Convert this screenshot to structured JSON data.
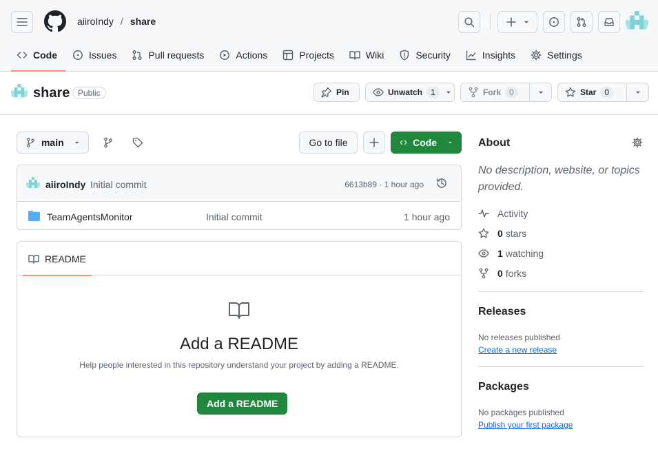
{
  "header": {
    "owner": "aiiroIndy",
    "separator": "/",
    "repo": "share"
  },
  "tabs": [
    {
      "label": "Code",
      "icon": "code-icon",
      "active": true
    },
    {
      "label": "Issues",
      "icon": "issue-icon"
    },
    {
      "label": "Pull requests",
      "icon": "pull-request-icon"
    },
    {
      "label": "Actions",
      "icon": "play-icon"
    },
    {
      "label": "Projects",
      "icon": "table-icon"
    },
    {
      "label": "Wiki",
      "icon": "book-icon"
    },
    {
      "label": "Security",
      "icon": "shield-icon"
    },
    {
      "label": "Insights",
      "icon": "graph-icon"
    },
    {
      "label": "Settings",
      "icon": "gear-icon"
    }
  ],
  "repo": {
    "name": "share",
    "visibility": "Public",
    "pin_label": "Pin",
    "watch_label": "Unwatch",
    "watch_count": "1",
    "fork_label": "Fork",
    "fork_count": "0",
    "star_label": "Star",
    "star_count": "0"
  },
  "toolbar": {
    "branch": "main",
    "go_to_file": "Go to file",
    "code_label": "Code"
  },
  "commit": {
    "author": "aiiroIndy",
    "message": "Initial commit",
    "meta": "6613b89 · 1 hour ago"
  },
  "files": [
    {
      "name": "TeamAgentsMonitor",
      "message": "Initial commit",
      "age": "1 hour ago",
      "icon": "folder-icon"
    }
  ],
  "readme": {
    "tab_label": "README",
    "title": "Add a README",
    "description": "Help people interested in this repository understand your project by adding a README.",
    "button": "Add a README"
  },
  "about": {
    "heading": "About",
    "description": "No description, website, or topics provided.",
    "activity": "Activity",
    "stars_count": "0",
    "stars_label": "stars",
    "watching_count": "1",
    "watching_label": "watching",
    "forks_count": "0",
    "forks_label": "forks"
  },
  "releases": {
    "heading": "Releases",
    "empty": "No releases published",
    "link": "Create a new release"
  },
  "packages": {
    "heading": "Packages",
    "empty": "No packages published",
    "link": "Publish your first package"
  },
  "colors": {
    "accent_green": "#1f883d",
    "tab_underline": "#fd8c73",
    "link_blue": "#0969da",
    "folder_blue": "#54aeff"
  }
}
